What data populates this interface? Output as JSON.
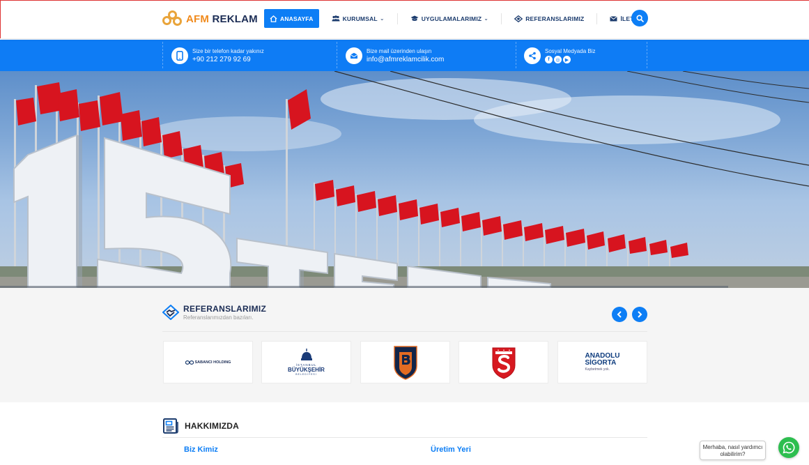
{
  "brand": {
    "part1": "AFM",
    "part2": "REKLAM"
  },
  "nav": {
    "items": [
      {
        "label": "ANASAYFA",
        "active": true
      },
      {
        "label": "KURUMSAL",
        "dropdown": true
      },
      {
        "label": "UYGULAMALARIMIZ",
        "dropdown": true
      },
      {
        "label": "REFERANSLARIMIZ"
      },
      {
        "label": "İLETİŞİM"
      }
    ],
    "accent": "#0d7ef5"
  },
  "contact": {
    "phone": {
      "label": "Size bir telefon kadar yakınız",
      "value": "+90 212 279 92 69"
    },
    "mail": {
      "label": "Bize mail üzerinden ulaşın",
      "value": "info@afmreklamcilik.com"
    },
    "social": {
      "label": "Sosyal Medyada Biz",
      "icons": [
        "facebook-icon",
        "instagram-icon",
        "youtube-icon"
      ]
    },
    "bar_color": "#0e7cf5"
  },
  "references": {
    "title": "REFERANSLARIMIZ",
    "subtitle": "Referanslarımızdan bazıları.",
    "logos": {
      "sabanci": "SABANCI HOLDING",
      "ibb_top": "İSTANBUL",
      "ibb_main": "BÜYÜKŞEHİR",
      "ibb_bottom": "BELEDİYESİ",
      "anadolu_1": "ANADOLU",
      "anadolu_2": "SİGORTA",
      "anadolu_3": "Kaybetmek yok."
    }
  },
  "about": {
    "title": "HAKKIMIZDA",
    "col1": "Biz Kimiz",
    "col2": "Üretim Yeri"
  },
  "chat": {
    "text": "Merhaba, nasıl yardımcı olabilirim?"
  }
}
